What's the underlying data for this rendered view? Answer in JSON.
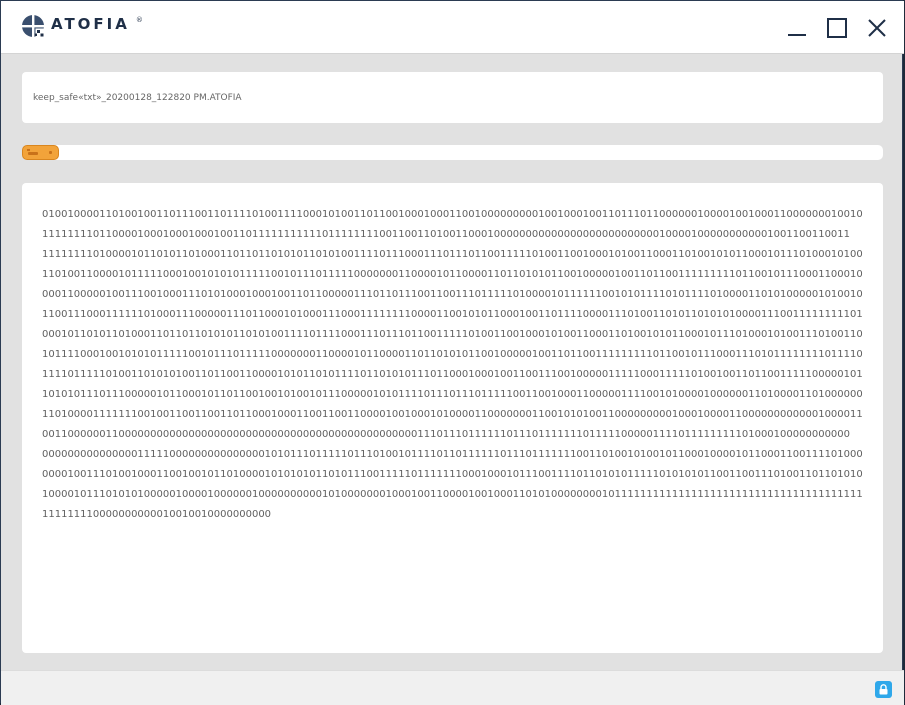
{
  "app": {
    "name": "ATOFIA",
    "reg_mark": "®"
  },
  "window_controls": {
    "minimize_icon": "minimize-icon",
    "maximize_icon": "maximize-icon",
    "close_icon": "close-icon"
  },
  "file": {
    "name": "keep_safe«txt»_20200128_122820 PM.ATOFIA"
  },
  "progress": {
    "fraction": 0.043,
    "color": "#f2a33a"
  },
  "binary": {
    "lines": [
      "0100100001101001001101110011011110100111100010100110110010001000110010000000001001000100110111011000000100001001000110000000100101",
      "1111111101100001000100010001001101111111111101111111100110011010011000100000000000000000000000000100001000000000001001100110011",
      "1111111101000010110101101000110110110101011010100111101110001110111011001111101001100100010100110001101001010110001011101000101001",
      "1101001100001011111000100101010111110010111011111000000011000010110000110110101011001000001001101100111111111011001011100011000100011",
      "0001100000100111001000111010100010001001101100000111011011100110011101111101000010111111001010111101011110100001101010000010100100100",
      "1100111000111111010001110000011101100010100011100011111111000011001010110001001101111000011101001101011010101000011100111111111010",
      "0001011010110100011011011010101101010011110111100011101110110011111010011001000101001100011010010101100010111010001010011101001100000",
      "1011110001001010101111100101110111110000000110000101100001101101010110010000010011011001111111110110010111000111010111111110111100",
      "1111011111010011010101001101100110000101011010111101101010111011000100010011001110010000011111000111110100100110110011111000001011100",
      "1010101110111000001011000101101100100101001011100000101011110111011101111100110010001100000111100101000010000001101000011010000000",
      "1101000011111110010011001100110110001000110011001100001001000101000011000000011001010100110000000001000100001100000000000010000110",
      "0011000000110000000000000000000000000000000000000000000000011101110111111011101111111011111000001111011111111101000100000000000",
      "0000000000000001111100000000000000010101110111110111010010111101101111110111011111110011010010100101100010000101100011001111010001011111",
      "0000100111010010001100100101101000010101010110101110011111011111110001000101110011110110101011111010101011001100111010011011010101011",
      "1000010111010101000001000010000001000000000010100000001000100110000100100011010100000000101111111111111111111111111111111111111111",
      "111111110000000000010010010000000000"
    ]
  },
  "status": {
    "lock_icon": "lock-icon",
    "lock_color": "#2fa8ea"
  }
}
